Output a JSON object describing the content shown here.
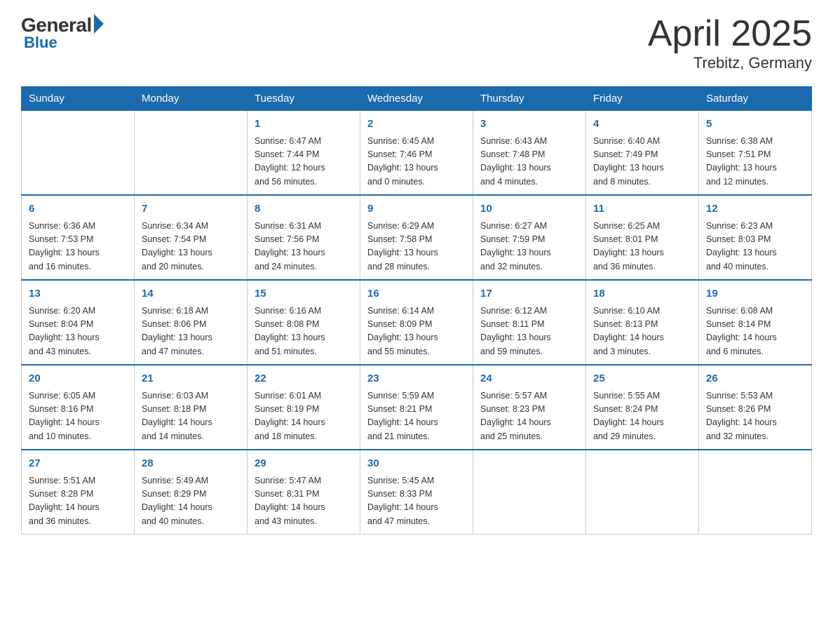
{
  "header": {
    "logo_general": "General",
    "logo_blue": "Blue",
    "title": "April 2025",
    "location": "Trebitz, Germany"
  },
  "days_of_week": [
    "Sunday",
    "Monday",
    "Tuesday",
    "Wednesday",
    "Thursday",
    "Friday",
    "Saturday"
  ],
  "weeks": [
    [
      {
        "day": "",
        "info": ""
      },
      {
        "day": "",
        "info": ""
      },
      {
        "day": "1",
        "info": "Sunrise: 6:47 AM\nSunset: 7:44 PM\nDaylight: 12 hours\nand 56 minutes."
      },
      {
        "day": "2",
        "info": "Sunrise: 6:45 AM\nSunset: 7:46 PM\nDaylight: 13 hours\nand 0 minutes."
      },
      {
        "day": "3",
        "info": "Sunrise: 6:43 AM\nSunset: 7:48 PM\nDaylight: 13 hours\nand 4 minutes."
      },
      {
        "day": "4",
        "info": "Sunrise: 6:40 AM\nSunset: 7:49 PM\nDaylight: 13 hours\nand 8 minutes."
      },
      {
        "day": "5",
        "info": "Sunrise: 6:38 AM\nSunset: 7:51 PM\nDaylight: 13 hours\nand 12 minutes."
      }
    ],
    [
      {
        "day": "6",
        "info": "Sunrise: 6:36 AM\nSunset: 7:53 PM\nDaylight: 13 hours\nand 16 minutes."
      },
      {
        "day": "7",
        "info": "Sunrise: 6:34 AM\nSunset: 7:54 PM\nDaylight: 13 hours\nand 20 minutes."
      },
      {
        "day": "8",
        "info": "Sunrise: 6:31 AM\nSunset: 7:56 PM\nDaylight: 13 hours\nand 24 minutes."
      },
      {
        "day": "9",
        "info": "Sunrise: 6:29 AM\nSunset: 7:58 PM\nDaylight: 13 hours\nand 28 minutes."
      },
      {
        "day": "10",
        "info": "Sunrise: 6:27 AM\nSunset: 7:59 PM\nDaylight: 13 hours\nand 32 minutes."
      },
      {
        "day": "11",
        "info": "Sunrise: 6:25 AM\nSunset: 8:01 PM\nDaylight: 13 hours\nand 36 minutes."
      },
      {
        "day": "12",
        "info": "Sunrise: 6:23 AM\nSunset: 8:03 PM\nDaylight: 13 hours\nand 40 minutes."
      }
    ],
    [
      {
        "day": "13",
        "info": "Sunrise: 6:20 AM\nSunset: 8:04 PM\nDaylight: 13 hours\nand 43 minutes."
      },
      {
        "day": "14",
        "info": "Sunrise: 6:18 AM\nSunset: 8:06 PM\nDaylight: 13 hours\nand 47 minutes."
      },
      {
        "day": "15",
        "info": "Sunrise: 6:16 AM\nSunset: 8:08 PM\nDaylight: 13 hours\nand 51 minutes."
      },
      {
        "day": "16",
        "info": "Sunrise: 6:14 AM\nSunset: 8:09 PM\nDaylight: 13 hours\nand 55 minutes."
      },
      {
        "day": "17",
        "info": "Sunrise: 6:12 AM\nSunset: 8:11 PM\nDaylight: 13 hours\nand 59 minutes."
      },
      {
        "day": "18",
        "info": "Sunrise: 6:10 AM\nSunset: 8:13 PM\nDaylight: 14 hours\nand 3 minutes."
      },
      {
        "day": "19",
        "info": "Sunrise: 6:08 AM\nSunset: 8:14 PM\nDaylight: 14 hours\nand 6 minutes."
      }
    ],
    [
      {
        "day": "20",
        "info": "Sunrise: 6:05 AM\nSunset: 8:16 PM\nDaylight: 14 hours\nand 10 minutes."
      },
      {
        "day": "21",
        "info": "Sunrise: 6:03 AM\nSunset: 8:18 PM\nDaylight: 14 hours\nand 14 minutes."
      },
      {
        "day": "22",
        "info": "Sunrise: 6:01 AM\nSunset: 8:19 PM\nDaylight: 14 hours\nand 18 minutes."
      },
      {
        "day": "23",
        "info": "Sunrise: 5:59 AM\nSunset: 8:21 PM\nDaylight: 14 hours\nand 21 minutes."
      },
      {
        "day": "24",
        "info": "Sunrise: 5:57 AM\nSunset: 8:23 PM\nDaylight: 14 hours\nand 25 minutes."
      },
      {
        "day": "25",
        "info": "Sunrise: 5:55 AM\nSunset: 8:24 PM\nDaylight: 14 hours\nand 29 minutes."
      },
      {
        "day": "26",
        "info": "Sunrise: 5:53 AM\nSunset: 8:26 PM\nDaylight: 14 hours\nand 32 minutes."
      }
    ],
    [
      {
        "day": "27",
        "info": "Sunrise: 5:51 AM\nSunset: 8:28 PM\nDaylight: 14 hours\nand 36 minutes."
      },
      {
        "day": "28",
        "info": "Sunrise: 5:49 AM\nSunset: 8:29 PM\nDaylight: 14 hours\nand 40 minutes."
      },
      {
        "day": "29",
        "info": "Sunrise: 5:47 AM\nSunset: 8:31 PM\nDaylight: 14 hours\nand 43 minutes."
      },
      {
        "day": "30",
        "info": "Sunrise: 5:45 AM\nSunset: 8:33 PM\nDaylight: 14 hours\nand 47 minutes."
      },
      {
        "day": "",
        "info": ""
      },
      {
        "day": "",
        "info": ""
      },
      {
        "day": "",
        "info": ""
      }
    ]
  ]
}
